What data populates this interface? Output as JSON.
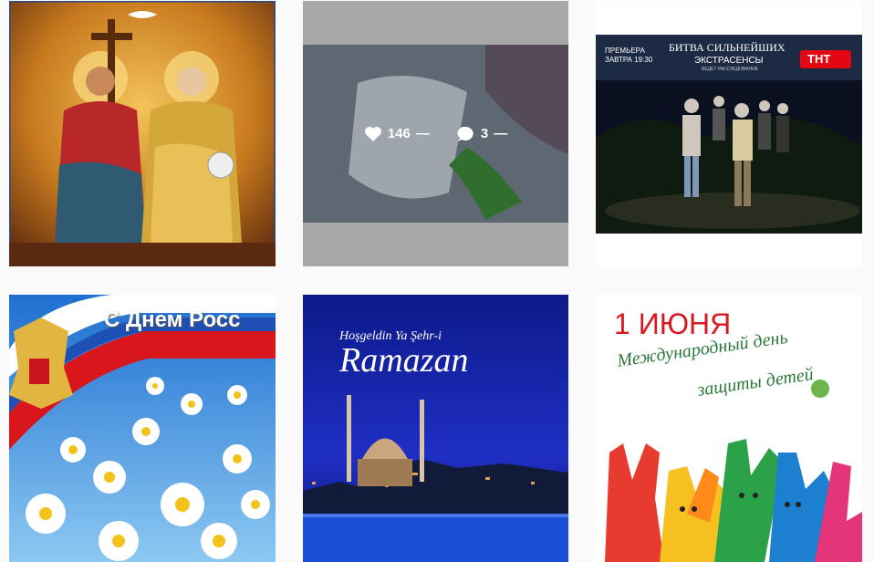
{
  "grid": {
    "posts": [
      {
        "alt": "icon"
      },
      {
        "likes": "146",
        "comments": "3",
        "dash": "—"
      },
      {
        "premiere": "ПРЕМЬЕРА\nЗАВТРА 19:30",
        "show_title": "БИТВА СИЛЬНЕЙШИХ",
        "show_subtitle": "ЭКСТРАСЕНСЫ",
        "small": "ВЕДЁТ РАССЛЕДОВАНИЕ",
        "channel": "ТНТ"
      },
      {
        "title": "С Днем Росс"
      },
      {
        "top": "Hoşgeldin Ya Şehr-i",
        "title": "Ramazan"
      },
      {
        "date": "1 ИЮНЯ",
        "line1": "Международный день",
        "line2": "защиты детей"
      }
    ]
  },
  "colors": {
    "page_bg": "#fafafa",
    "overlay_dim": "rgba(0,0,0,0.3)",
    "tnt_red": "#e30613",
    "june_red": "#d71920"
  }
}
